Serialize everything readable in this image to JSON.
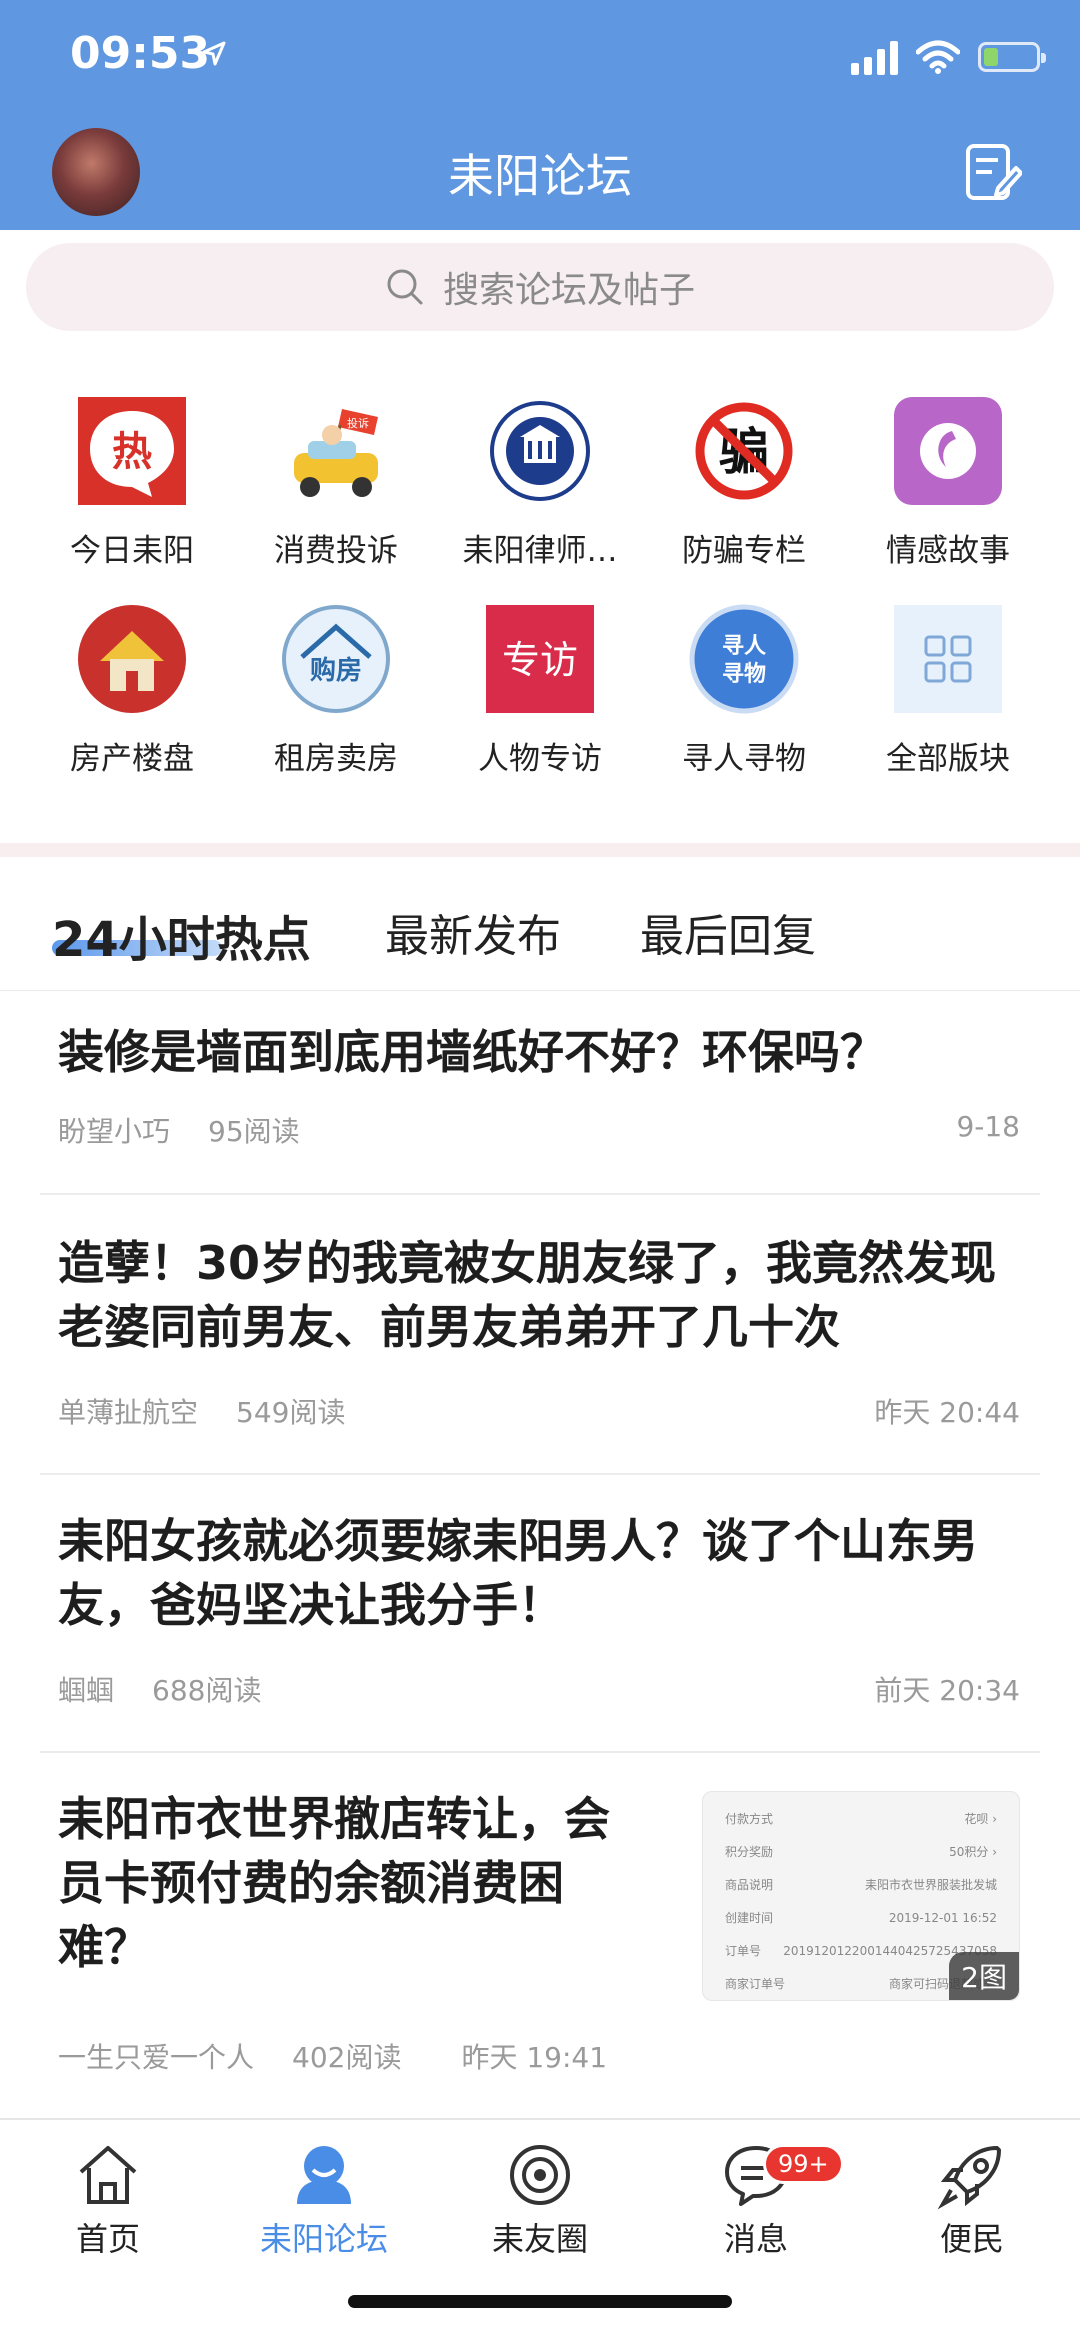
{
  "status": {
    "time": "09:53"
  },
  "header": {
    "title": "耒阳论坛"
  },
  "search": {
    "placeholder": "搜索论坛及帖子"
  },
  "categories": [
    {
      "label": "今日耒阳",
      "icon": "hot-icon",
      "icon_text": "热"
    },
    {
      "label": "消费投诉",
      "icon": "complaint-car-icon",
      "icon_text": "投诉"
    },
    {
      "label": "耒阳律师…",
      "icon": "lawyer-emblem-icon"
    },
    {
      "label": "防骗专栏",
      "icon": "anti-fraud-icon",
      "icon_text": "骗"
    },
    {
      "label": "情感故事",
      "icon": "emotion-story-icon"
    },
    {
      "label": "房产楼盘",
      "icon": "house-icon"
    },
    {
      "label": "租房卖房",
      "icon": "rent-house-icon",
      "icon_text": "购房"
    },
    {
      "label": "人物专访",
      "icon": "interview-icon",
      "icon_text": "专访"
    },
    {
      "label": "寻人寻物",
      "icon": "lost-found-icon",
      "icon_text": "寻人寻物"
    },
    {
      "label": "全部版块",
      "icon": "all-sections-icon"
    }
  ],
  "tabs": [
    "24小时热点",
    "最新发布",
    "最后回复"
  ],
  "posts": [
    {
      "title": "装修是墙面到底用墙纸好不好？环保吗？",
      "author": "盼望小巧",
      "reads": "95阅读",
      "time": "9-18"
    },
    {
      "title": "造孽！30岁的我竟被女朋友绿了，我竟然发现老婆同前男友、前男友弟弟开了几十次",
      "author": "单薄扯航空",
      "reads": "549阅读",
      "time": "昨天 20:44"
    },
    {
      "title": "耒阳女孩就必须要嫁耒阳男人？谈了个山东男友，爸妈坚决让我分手！",
      "author": "蝈蝈",
      "reads": "688阅读",
      "time": "前天 20:34"
    },
    {
      "title": "耒阳市衣世界撤店转让，会员卡预付费的余额消费困难？",
      "author": "一生只爱一个人",
      "reads": "402阅读",
      "time": "昨天 19:41",
      "image_count": "2图",
      "thumb_rows": [
        [
          "付款方式",
          "花呗 ›"
        ],
        [
          "积分奖励",
          "50积分 ›"
        ],
        [
          "商品说明",
          "耒阳市衣世界服装批发城"
        ],
        [
          "创建时间",
          "2019-12-01 16:52"
        ],
        [
          "订单号",
          "20191201220014404257254370​58"
        ],
        [
          "商家订单号",
          "商家可扫码退款或查"
        ]
      ]
    }
  ],
  "tabbar": [
    {
      "label": "首页",
      "icon": "home-icon"
    },
    {
      "label": "耒阳论坛",
      "icon": "forum-icon",
      "active": true
    },
    {
      "label": "耒友圈",
      "icon": "circle-icon"
    },
    {
      "label": "消息",
      "icon": "message-icon",
      "badge": "99+"
    },
    {
      "label": "便民",
      "icon": "rocket-icon"
    }
  ],
  "colors": {
    "header": "#5f97e0",
    "accent": "#4a8de6",
    "badge": "#e8352f"
  }
}
